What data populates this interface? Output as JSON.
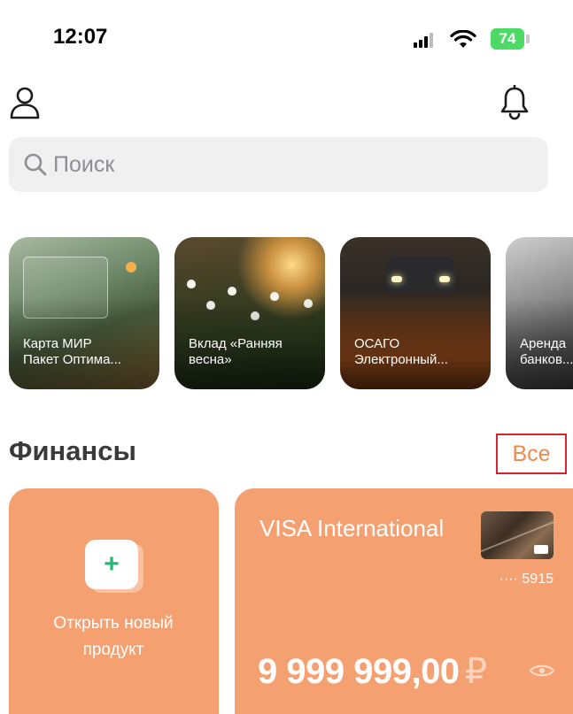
{
  "status_bar": {
    "time": "12:07",
    "battery": "74",
    "battery_color": "#4cd964"
  },
  "header": {
    "profile_icon": "person-icon",
    "notifications_icon": "bell-icon"
  },
  "search": {
    "placeholder": "Поиск",
    "icon": "search-icon"
  },
  "stories": [
    {
      "line1": "Карта МИР",
      "line2": "Пакет Оптима..."
    },
    {
      "line1": "Вклад «Ранняя",
      "line2": "весна»"
    },
    {
      "line1": "ОСАГО",
      "line2": "Электронный..."
    },
    {
      "line1": "Аренда",
      "line2": "банков..."
    }
  ],
  "finances": {
    "title": "Финансы",
    "all_label": "Все",
    "accent_color": "#f5a070",
    "link_color": "#f08a4b",
    "new_product": {
      "label_line1": "Открыть новый",
      "label_line2": "продукт",
      "icon": "plus-icon"
    },
    "card": {
      "name": "VISA  International",
      "number": "···· 5915",
      "balance": "9 999 999,00",
      "currency": "₽",
      "visibility_icon": "eye-icon"
    }
  }
}
